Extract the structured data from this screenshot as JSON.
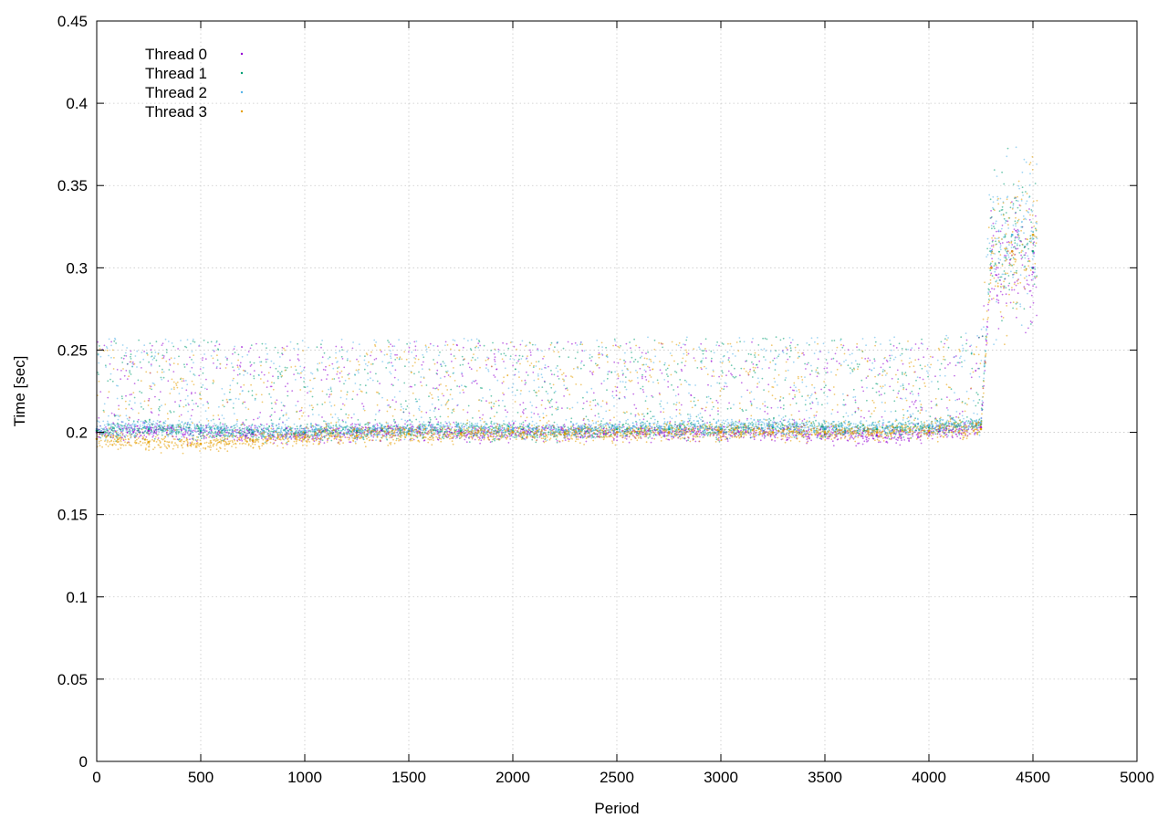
{
  "chart_data": {
    "type": "scatter",
    "title": "",
    "xlabel": "Period",
    "ylabel": "Time [sec]",
    "xlim": [
      0,
      5000
    ],
    "ylim": [
      0,
      0.45
    ],
    "x_ticks": [
      "0",
      "500",
      "1000",
      "1500",
      "2000",
      "2500",
      "3000",
      "3500",
      "4000",
      "4500",
      "5000"
    ],
    "y_ticks": [
      "0",
      "0.05",
      "0.1",
      "0.15",
      "0.2",
      "0.25",
      "0.3",
      "0.35",
      "0.4",
      "0.45"
    ],
    "grid": true,
    "legend_position": "top-left",
    "series": [
      {
        "name": "Thread 0",
        "color": "#9400d3",
        "points": [
          [
            0,
            0.2
          ],
          [
            250,
            0.201
          ],
          [
            500,
            0.2
          ],
          [
            750,
            0.199
          ],
          [
            1000,
            0.199
          ],
          [
            1250,
            0.2
          ],
          [
            1500,
            0.201
          ],
          [
            1750,
            0.2
          ],
          [
            2000,
            0.2
          ],
          [
            2250,
            0.2
          ],
          [
            2500,
            0.2
          ],
          [
            2750,
            0.2
          ],
          [
            3000,
            0.2
          ],
          [
            3250,
            0.2
          ],
          [
            3500,
            0.199
          ],
          [
            3750,
            0.198
          ],
          [
            4000,
            0.2
          ],
          [
            4250,
            0.203
          ],
          [
            4300,
            0.3
          ],
          [
            4400,
            0.31
          ],
          [
            4500,
            0.3
          ]
        ]
      },
      {
        "name": "Thread 1",
        "color": "#009e73",
        "points": [
          [
            0,
            0.201
          ],
          [
            250,
            0.202
          ],
          [
            500,
            0.201
          ],
          [
            750,
            0.2
          ],
          [
            1000,
            0.2
          ],
          [
            1250,
            0.201
          ],
          [
            1500,
            0.201
          ],
          [
            1750,
            0.201
          ],
          [
            2000,
            0.201
          ],
          [
            2250,
            0.2
          ],
          [
            2500,
            0.202
          ],
          [
            2750,
            0.202
          ],
          [
            3000,
            0.202
          ],
          [
            3250,
            0.203
          ],
          [
            3500,
            0.202
          ],
          [
            3750,
            0.202
          ],
          [
            4000,
            0.203
          ],
          [
            4250,
            0.205
          ],
          [
            4300,
            0.31
          ],
          [
            4400,
            0.32
          ],
          [
            4500,
            0.31
          ]
        ]
      },
      {
        "name": "Thread 2",
        "color": "#56b4e9",
        "points": [
          [
            0,
            0.202
          ],
          [
            250,
            0.203
          ],
          [
            500,
            0.202
          ],
          [
            750,
            0.201
          ],
          [
            1000,
            0.201
          ],
          [
            1250,
            0.202
          ],
          [
            1500,
            0.202
          ],
          [
            1750,
            0.202
          ],
          [
            2000,
            0.202
          ],
          [
            2250,
            0.201
          ],
          [
            2500,
            0.203
          ],
          [
            2750,
            0.203
          ],
          [
            3000,
            0.203
          ],
          [
            3250,
            0.204
          ],
          [
            3500,
            0.203
          ],
          [
            3750,
            0.203
          ],
          [
            4000,
            0.204
          ],
          [
            4250,
            0.206
          ],
          [
            4300,
            0.31
          ],
          [
            4400,
            0.32
          ],
          [
            4500,
            0.32
          ]
        ]
      },
      {
        "name": "Thread 3",
        "color": "#e69f00",
        "points": [
          [
            0,
            0.196
          ],
          [
            250,
            0.194
          ],
          [
            500,
            0.193
          ],
          [
            750,
            0.195
          ],
          [
            1000,
            0.197
          ],
          [
            1250,
            0.198
          ],
          [
            1500,
            0.199
          ],
          [
            1750,
            0.199
          ],
          [
            2000,
            0.2
          ],
          [
            2250,
            0.199
          ],
          [
            2500,
            0.2
          ],
          [
            2750,
            0.2
          ],
          [
            3000,
            0.2
          ],
          [
            3250,
            0.2
          ],
          [
            3500,
            0.2
          ],
          [
            3750,
            0.2
          ],
          [
            4000,
            0.201
          ],
          [
            4250,
            0.202
          ],
          [
            4300,
            0.3
          ],
          [
            4400,
            0.31
          ],
          [
            4500,
            0.32
          ]
        ]
      }
    ]
  }
}
